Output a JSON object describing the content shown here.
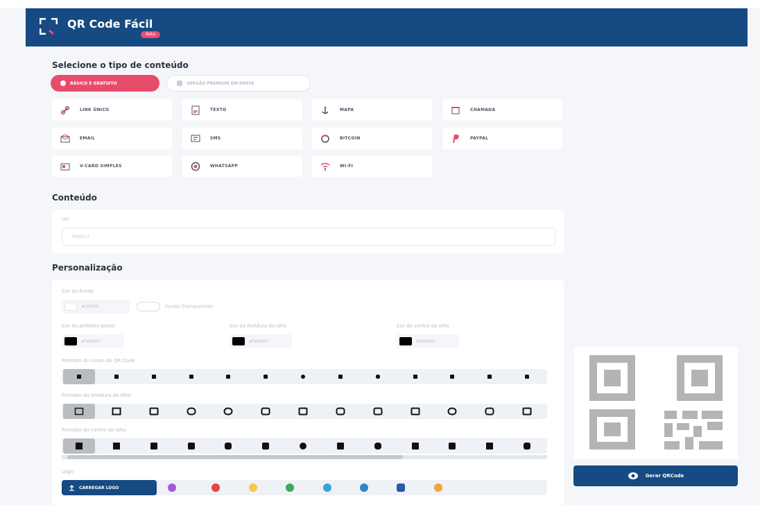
{
  "header": {
    "title": "QR Code Fácil",
    "badge": "Beta"
  },
  "content_type": {
    "title": "Selecione o tipo de conteúdo",
    "tab_basic": "BÁSICO E GRATUITO",
    "tab_premium": "VERSÃO PREMIUM EM BREVE",
    "types": [
      {
        "label": "LINK ÚNICO",
        "icon": "link-icon"
      },
      {
        "label": "TEXTO",
        "icon": "text-file-icon"
      },
      {
        "label": "MAPA",
        "icon": "map-anchor-icon"
      },
      {
        "label": "CHAMADA",
        "icon": "phone-icon"
      },
      {
        "label": "EMAIL",
        "icon": "envelope-icon"
      },
      {
        "label": "SMS",
        "icon": "sms-icon"
      },
      {
        "label": "BITCOIN",
        "icon": "bitcoin-icon"
      },
      {
        "label": "PAYPAL",
        "icon": "paypal-icon"
      },
      {
        "label": "V-CARD SIMPLES",
        "icon": "vcard-icon"
      },
      {
        "label": "WHATSAPP",
        "icon": "whatsapp-icon"
      },
      {
        "label": "WI-FI",
        "icon": "wifi-icon"
      }
    ]
  },
  "conteudo": {
    "title": "Conteúdo",
    "url_label": "Url",
    "url_placeholder": "https://"
  },
  "personalizacao": {
    "title": "Personalização",
    "bg_label": "Cor do Fundo",
    "bg_value": "#FFFFFF",
    "transparent_label": "Fundo Transparente",
    "fg_label": "Cor do primeiro plano",
    "fg_value": "#000000",
    "eye_frame_label": "Cor da moldura do olho",
    "eye_frame_value": "#000000",
    "eye_center_label": "Cor do centro do olho",
    "eye_center_value": "#000000",
    "body_shape_label": "Formato do corpo do QR Code",
    "eye_frame_shape_label": "Formato da moldura do olho",
    "eye_center_shape_label": "Formato do centro do olho",
    "logo_label": "Logo",
    "upload_label": "CARREGAR LOGO",
    "logo_icons": [
      "facebook-messenger-icon",
      "youtube-icon",
      "smile-icon",
      "whatsapp-icon",
      "telegram-icon",
      "skype-icon",
      "user-icon",
      "bitcoin-icon"
    ]
  },
  "colors": {
    "primary": "#154a82",
    "accent": "#e94b6a"
  },
  "actions": {
    "generate_label": "Gerar QRCode"
  }
}
